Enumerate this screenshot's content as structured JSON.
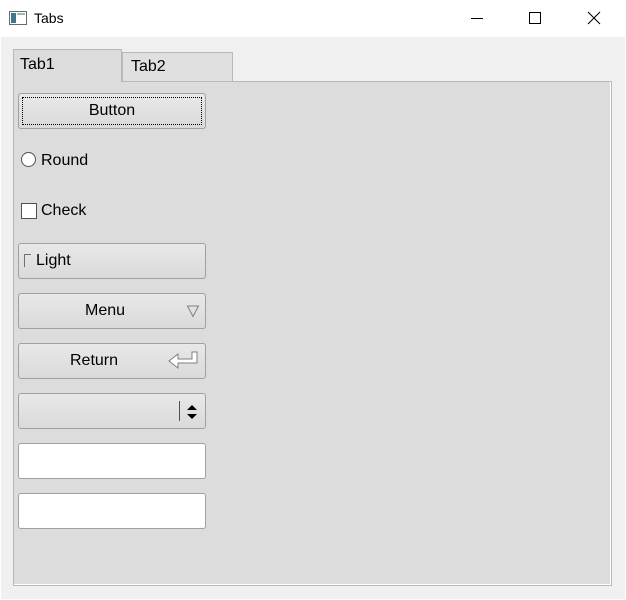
{
  "window": {
    "title": "Tabs",
    "controls": {
      "minimize": "minimize-icon",
      "maximize": "maximize-icon",
      "close": "close-icon"
    }
  },
  "tabs": [
    {
      "label": "Tab1",
      "active": true
    },
    {
      "label": "Tab2",
      "active": false
    }
  ],
  "panel": {
    "push_button_label": "Button",
    "radio_label": "Round",
    "radio_checked": false,
    "check_label": "Check",
    "check_checked": false,
    "light_label": "Light",
    "menu_label": "Menu",
    "return_label": "Return",
    "spin_value": "",
    "edit1_value": "",
    "edit2_value": ""
  },
  "colors": {
    "panel_bg": "#dcdcdc",
    "client_bg": "#f0f0f0",
    "border": "#a0a0a0"
  }
}
